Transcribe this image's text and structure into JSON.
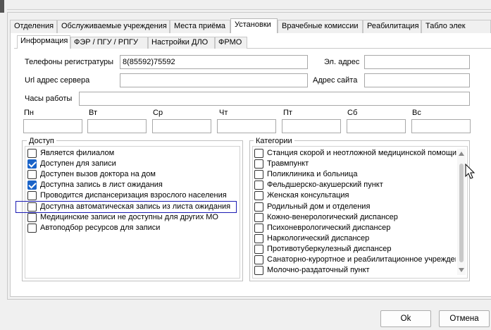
{
  "tabs": [
    "Отделения",
    "Обслуживаемые учреждения",
    "Места приёма",
    "Установки",
    "Врачебные комиссии",
    "Реабилитация",
    "Табло элек"
  ],
  "active_tab": "Установки",
  "subtabs": [
    "Информация",
    "ФЭР / ПГУ / РПГУ",
    "Настройки ДЛО",
    "ФРМО"
  ],
  "active_subtab": "Информация",
  "form": {
    "phones_label": "Телефоны регистратуры",
    "phones_value": "8(85592)75592",
    "email_label": "Эл. адрес",
    "email_value": "",
    "server_url_label": "Url адрес сервера",
    "server_url_value": "",
    "site_label": "Адрес сайта",
    "site_value": "",
    "hours_label": "Часы работы",
    "hours_value": ""
  },
  "days": [
    "Пн",
    "Вт",
    "Ср",
    "Чт",
    "Пт",
    "Сб",
    "Вс"
  ],
  "access": {
    "title": "Доступ",
    "items": [
      {
        "label": "Является филиалом",
        "checked": false
      },
      {
        "label": "Доступен для записи",
        "checked": true
      },
      {
        "label": "Доступен вызов доктора на дом",
        "checked": false
      },
      {
        "label": "Доступна запись в лист ожидания",
        "checked": true
      },
      {
        "label": "Проводится диспансеризация взрослого населения",
        "checked": false
      },
      {
        "label": "Доступна автоматическая запись из листа ожидания",
        "checked": false
      },
      {
        "label": "Медицинские записи не доступны для других МО",
        "checked": false
      },
      {
        "label": "Автоподбор ресурсов для записи",
        "checked": false
      }
    ]
  },
  "categories": {
    "title": "Категории",
    "items": [
      "Станция скорой и неотложной медицинской помощи",
      "Травмпункт",
      "Поликлиника и больница",
      "Фельдшерско-акушерский пункт",
      "Женская консультация",
      "Родильный дом и отделения",
      "Кожно-венерологический диспансер",
      "Психоневрологический диспансер",
      "Наркологический диспансер",
      "Противотуберкулезный диспансер",
      "Санаторно-курортное и реабилитационное учрежден",
      "Молочно-раздаточный пункт"
    ]
  },
  "buttons": {
    "ok": "Ok",
    "cancel": "Отмена"
  },
  "colors": {
    "accent": "#1a63c8",
    "highlight_border": "#1b1bb3"
  }
}
